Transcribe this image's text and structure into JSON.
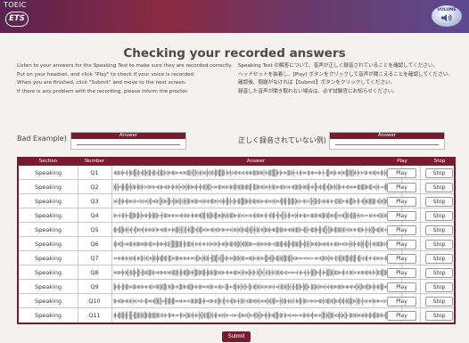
{
  "header": {
    "brand": "TOEIC",
    "logo": "ETS",
    "badge": "VOLUME",
    "colors": {
      "accent": "#7a1a2e"
    }
  },
  "title": "Checking your recorded answers",
  "instructions_en": [
    "Listen to your answers for the Speaking Test to make sure they are recorded correctly.",
    "Put on your headset, and click \"Play\" to check if your voice is recorded.",
    "When you are finished, click \"Submit\" and move to the next screen.",
    "If there is any problem with the recording, please inform the proctor."
  ],
  "instructions_ja": [
    "Speaking Test の解答について、音声が正しく録音されていることを確認してください。",
    "ヘッドセットを装着し、[Play] ボタンをクリックして音声が聞こえることを確認してください。",
    "確認後、問題がなければ【Submit】ボタンをクリックしてください。",
    "録音した音声が聞き取れない場合は、必ず試験官にお知らせください。"
  ],
  "examples": {
    "en_label": "Bad Example)",
    "ja_label": "正しく録音されていない例)",
    "answer_header": "Answer"
  },
  "table": {
    "headers": {
      "section": "Section",
      "number": "Number",
      "answer": "Answer",
      "play": "Play",
      "stop": "Stop"
    },
    "rows": [
      {
        "section": "Speaking",
        "number": "Q1"
      },
      {
        "section": "Speaking",
        "number": "Q2"
      },
      {
        "section": "Speaking",
        "number": "Q3"
      },
      {
        "section": "Speaking",
        "number": "Q4"
      },
      {
        "section": "Speaking",
        "number": "Q5"
      },
      {
        "section": "Speaking",
        "number": "Q6"
      },
      {
        "section": "Speaking",
        "number": "Q7"
      },
      {
        "section": "Speaking",
        "number": "Q8"
      },
      {
        "section": "Speaking",
        "number": "Q9"
      },
      {
        "section": "Speaking",
        "number": "Q10"
      },
      {
        "section": "Speaking",
        "number": "Q11"
      }
    ],
    "play_label": "Play",
    "stop_label": "Stop"
  },
  "submit_label": "Submit"
}
